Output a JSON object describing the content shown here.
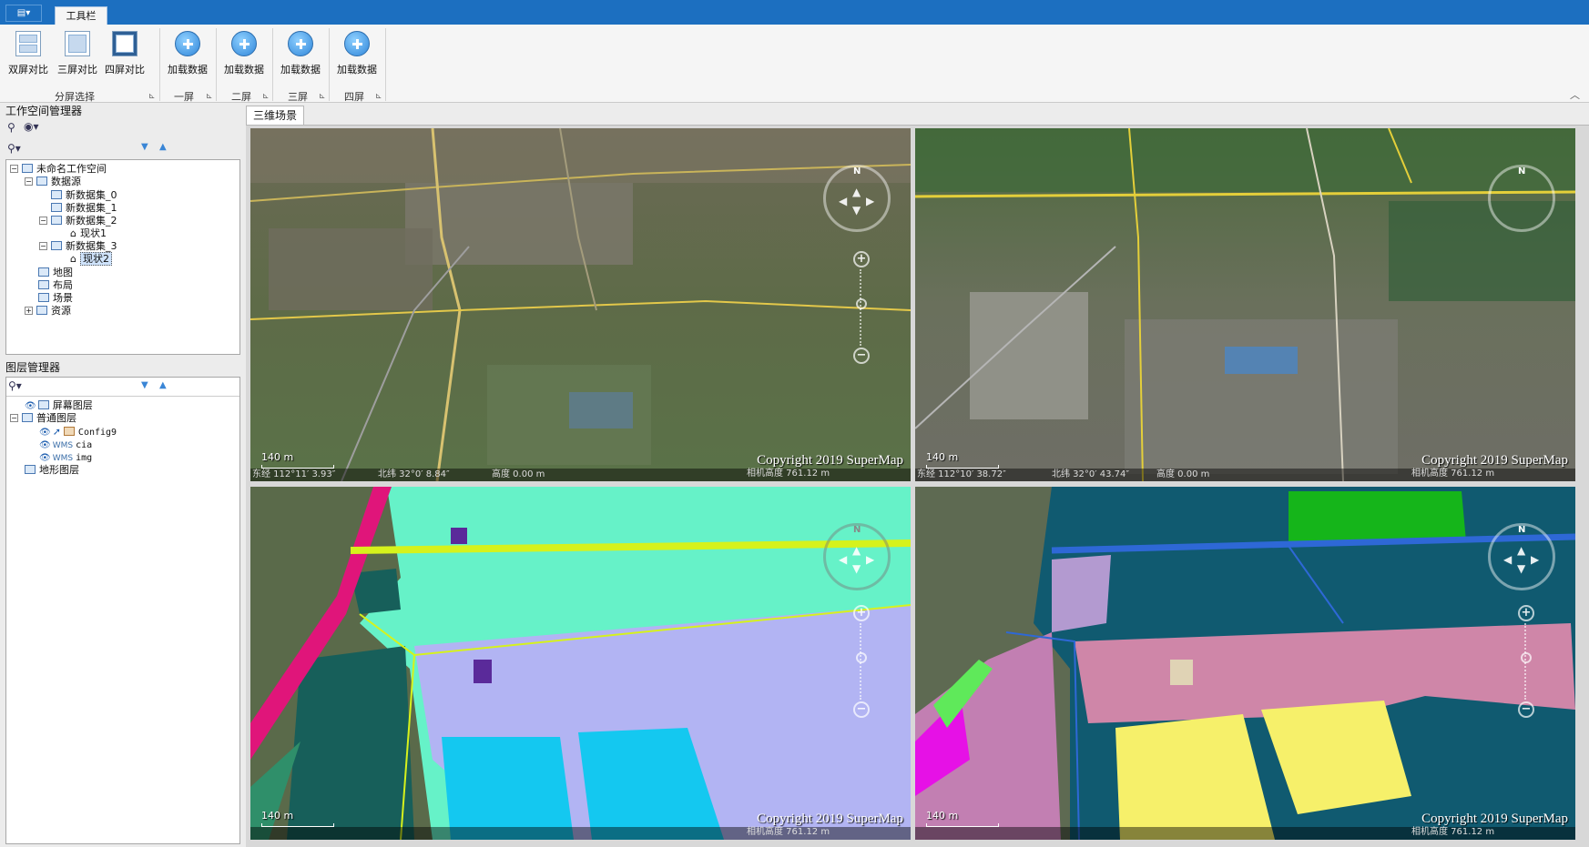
{
  "ribbon": {
    "app_menu_label": "▤▾",
    "tab_label": "工具栏",
    "buttons": {
      "dual": "双屏对比",
      "triple": "三屏对比",
      "quad": "四屏对比",
      "load1": "加载数据",
      "load2": "加载数据",
      "load3": "加载数据",
      "load4": "加载数据"
    },
    "groups": {
      "split": "分屏选择",
      "screen1": "一屏",
      "screen2": "二屏",
      "screen3": "三屏",
      "screen4": "四屏"
    }
  },
  "workspace": {
    "title": "工作空间管理器",
    "tree": {
      "root": "未命名工作空间",
      "datasources": "数据源",
      "ds0": "新数据集_0",
      "ds1": "新数据集_1",
      "ds2": "新数据集_2",
      "ds2_child": "现状1",
      "ds3": "新数据集_3",
      "ds3_child": "现状2",
      "maps": "地图",
      "layouts": "布局",
      "scenes": "场景",
      "resources": "资源"
    }
  },
  "layers": {
    "title": "图层管理器",
    "tree": {
      "screen_layers": "屏幕图层",
      "normal_layers": "普通图层",
      "config": "Config9",
      "cia": "cia",
      "img": "img",
      "terrain_layers": "地形图层"
    }
  },
  "scene": {
    "tab_label": "三维场景",
    "views": [
      {
        "copyright": "Copyright 2019 SuperMap",
        "scale": "140 m",
        "lon": "东经 112°11′ 3.93″",
        "lat": "北纬 32°0′ 8.84″",
        "height": "高度 0.00 m",
        "camera": "相机高度 761.12 m"
      },
      {
        "copyright": "Copyright 2019 SuperMap",
        "scale": "140 m",
        "lon": "东经 112°10′ 38.72″",
        "lat": "北纬 32°0′ 43.74″",
        "height": "高度 0.00 m",
        "camera": "相机高度 761.12 m"
      },
      {
        "copyright": "Copyright 2019 SuperMap",
        "scale": "140 m",
        "lon": "",
        "lat": "",
        "height": "",
        "camera": "相机高度 761.12 m"
      },
      {
        "copyright": "Copyright 2019 SuperMap",
        "scale": "140 m",
        "lon": "",
        "lat": "",
        "height": "",
        "camera": "相机高度 761.12 m"
      }
    ]
  }
}
